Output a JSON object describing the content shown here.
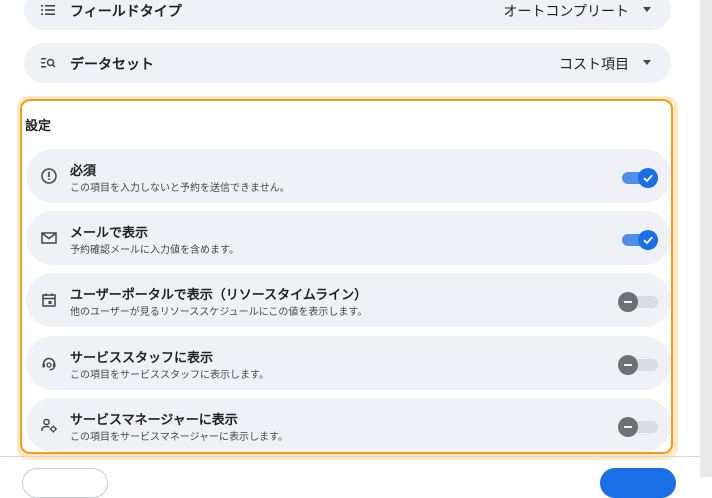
{
  "fields": {
    "field_type": {
      "label": "フィールドタイプ",
      "value": "オートコンプリート"
    },
    "dataset": {
      "label": "データセット",
      "value": "コスト項目"
    }
  },
  "settings": {
    "title": "設定",
    "items": [
      {
        "title": "必須",
        "description": "この項目を入力しないと予約を送信できません。",
        "enabled": true
      },
      {
        "title": "メールで表示",
        "description": "予約確認メールに入力値を含めます。",
        "enabled": true
      },
      {
        "title": "ユーザーポータルで表示（リソースタイムライン）",
        "description": "他のユーザーが見るリソーススケジュールにこの値を表示します。",
        "enabled": false
      },
      {
        "title": "サービススタッフに表示",
        "description": "この項目をサービススタッフに表示します。",
        "enabled": false
      },
      {
        "title": "サービスマネージャーに表示",
        "description": "この項目をサービスマネージャーに表示します。",
        "enabled": false
      }
    ]
  },
  "colors": {
    "accent": "#1a6ee8",
    "highlight_border": "#f29d1b",
    "row_background": "#eff1f6"
  }
}
